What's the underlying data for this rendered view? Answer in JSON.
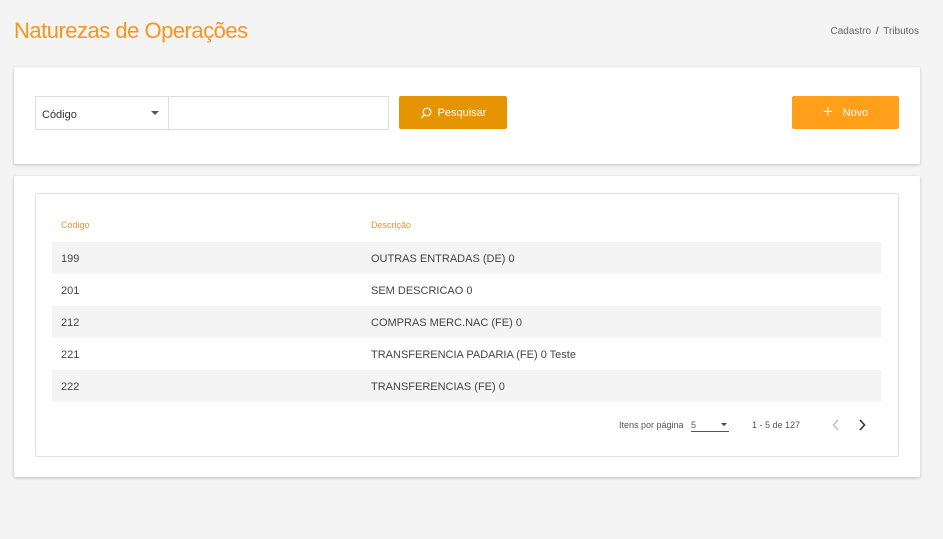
{
  "header": {
    "title": "Naturezas de Operações",
    "breadcrumb": {
      "parent": "Cadastro",
      "separator": "/",
      "current": "Tributos"
    }
  },
  "search": {
    "field_select": "Código",
    "input_value": "",
    "input_placeholder": "",
    "search_button": "Pesquisar",
    "new_button": "Novo"
  },
  "table": {
    "columns": [
      "Código",
      "Descrição"
    ],
    "rows": [
      {
        "code": "199",
        "desc": "OUTRAS ENTRADAS (DE) 0"
      },
      {
        "code": "201",
        "desc": "SEM DESCRICAO 0"
      },
      {
        "code": "212",
        "desc": "COMPRAS MERC.NAC (FE) 0"
      },
      {
        "code": "221",
        "desc": "TRANSFERENCIA PADARIA (FE) 0 Teste"
      },
      {
        "code": "222",
        "desc": "TRANSFERENCIAS (FE) 0"
      }
    ]
  },
  "pagination": {
    "items_per_page_label": "Itens por página",
    "items_per_page": "5",
    "range": "1 - 5 de 127"
  },
  "colors": {
    "accent": "#f7941d",
    "search_button": "#e59400",
    "new_button": "#ff9f1a"
  },
  "icons": {
    "search": "search-icon",
    "add": "plus-icon",
    "prev": "chevron-left-icon",
    "next": "chevron-right-icon"
  }
}
